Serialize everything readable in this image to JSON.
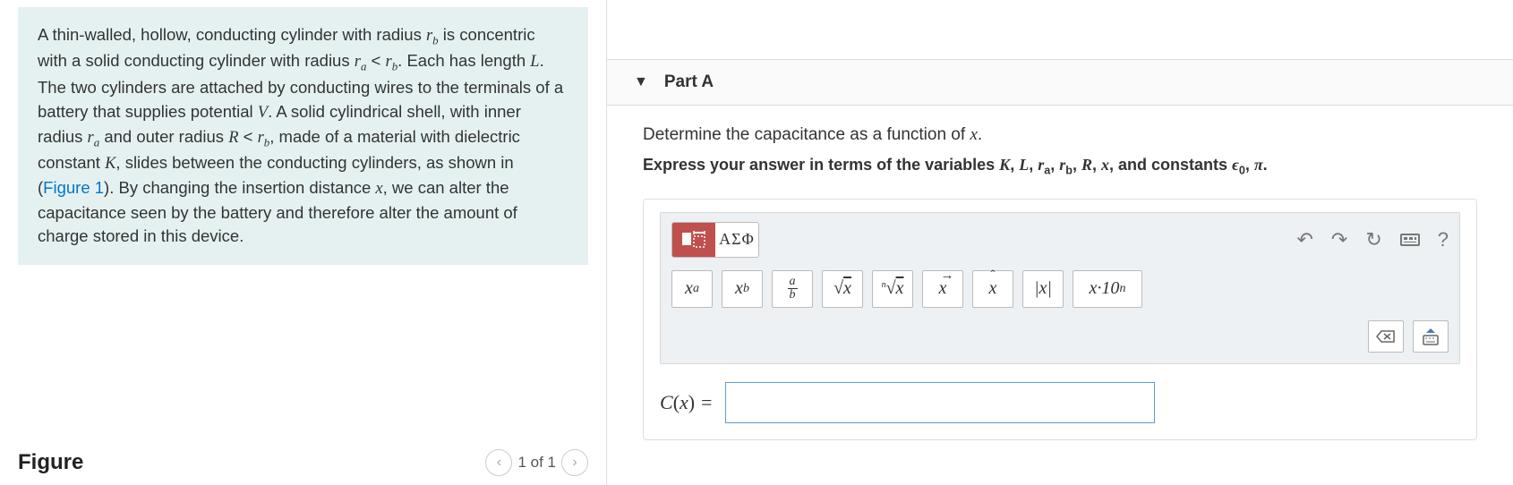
{
  "problem": {
    "text_html": "A thin-walled, hollow, conducting cylinder with radius <span class='mathit'>r<sub>b</sub></span> is concentric with a solid conducting cylinder with radius <span class='mathit'>r<sub>a</sub></span> &lt; <span class='mathit'>r<sub>b</sub></span>. Each has length <span class='mathit'>L</span>. The two cylinders are attached by conducting wires to the terminals of a battery that supplies potential <span class='mathit'>V</span>. A solid cylindrical shell, with inner radius <span class='mathit'>r<sub>a</sub></span> and outer radius <span class='mathit'>R</span> &lt; <span class='mathit'>r<sub>b</sub></span>, made of a material with dielectric constant <span class='mathit'>K</span>, slides between the conducting cylinders, as shown in (<a href='#'>Figure 1</a>). By changing the insertion distance <span class='mathit'>x</span>, we can alter the capacitance seen by the battery and therefore alter the amount of charge stored in this device."
  },
  "figure": {
    "title": "Figure",
    "page_indicator": "1 of 1"
  },
  "part": {
    "label": "Part A",
    "prompt_html": "Determine the capacitance as a function of <span class='mathit'>x</span>.",
    "hint_html": "Express your answer in terms of the variables <span class='mathit'>K</span>, <span class='mathit'>L</span>, <span class='mathit'>r</span><sub>a</sub>, <span class='mathit'>r</span><sub>b</sub>, <span class='mathit'>R</span>, <span class='mathit'>x</span>, and constants <span class='mathit'>ϵ</span><sub>0</sub>, <span class='mathit'>π</span>."
  },
  "answer": {
    "lhs_html": "<span class='mathit'>C</span><span class='paren'>(</span><span class='mathit'>x</span><span class='paren'>)</span> =",
    "value": ""
  },
  "toolbar": {
    "tab_templates": "templates-icon",
    "tab_greek": "ΑΣΦ",
    "ops": {
      "power_html": "x<sup style='font-style:italic'>a</sup>",
      "subscript_html": "x<sub style='font-style:italic'>b</sub>",
      "fraction_html": "<span class='frac'><span class='num'>a</span><span class='den'>b</span></span>",
      "sqrt_html": "<span class='sqrt'>√</span><span style='text-decoration:overline;'>x</span>",
      "nroot_html": "<sup style='font-size:10px;font-style:italic;position:relative;top:-4px;'>n</sup><span class='sqrt'>√</span><span style='text-decoration:overline;'>x</span>",
      "vector_html": "<span class='xhat'><span class='hat'>→</span>x</span>",
      "hat_html": "<span class='xhat'><span class='hat'>ˆ</span>x</span>",
      "abs": "|x|",
      "sci_html": "x·10<sup style='font-style:italic'>n</sup>"
    }
  }
}
